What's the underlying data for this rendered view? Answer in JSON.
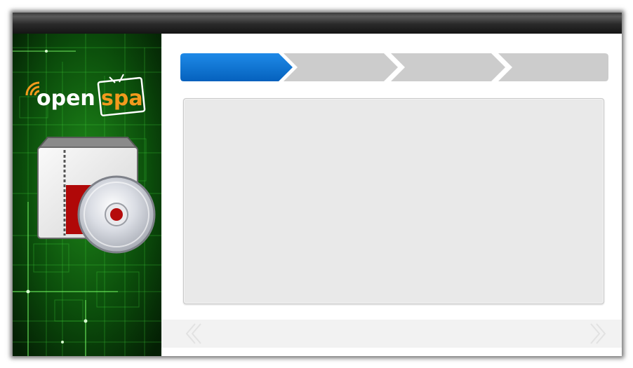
{
  "brand": {
    "logo_text_primary": "open",
    "logo_text_accent": "spa",
    "accent_color": "#f39a1d",
    "logo_text_color": "#ffffff"
  },
  "wizard": {
    "steps": [
      {
        "label": "",
        "state": "active",
        "color": "#0a74d4"
      },
      {
        "label": "",
        "state": "inactive",
        "color": "#cccccc"
      },
      {
        "label": "",
        "state": "inactive",
        "color": "#cccccc"
      },
      {
        "label": "",
        "state": "inactive",
        "color": "#cccccc"
      }
    ],
    "panel_text": ""
  },
  "footer": {
    "back_icon": "chevron-left-double-icon",
    "next_icon": "chevron-right-double-icon"
  },
  "sidebar": {
    "icon": "package-installer-disc-icon",
    "background": "green-circuit-pattern"
  }
}
